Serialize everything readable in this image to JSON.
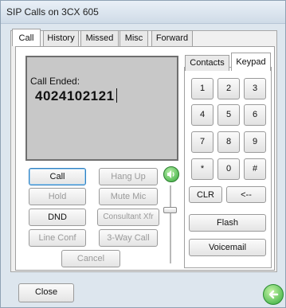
{
  "window": {
    "title": "SIP Calls on 3CX 605"
  },
  "tabs": [
    "Call",
    "History",
    "Missed",
    "Misc",
    "Forward"
  ],
  "display": {
    "status": "Call Ended:",
    "number": "4024102121"
  },
  "buttons": {
    "call": "Call",
    "hang_up": "Hang Up",
    "hold": "Hold",
    "mute_mic": "Mute Mic",
    "dnd": "DND",
    "consultant_xfr": "Consultant Xfr",
    "line_conf": "Line Conf",
    "three_way": "3-Way Call",
    "cancel": "Cancel",
    "close": "Close"
  },
  "right_tabs": [
    "Contacts",
    "Keypad"
  ],
  "keypad": {
    "keys": [
      "1",
      "2",
      "3",
      "4",
      "5",
      "6",
      "7",
      "8",
      "9",
      "*",
      "0",
      "#"
    ],
    "clr": "CLR",
    "back": "<--",
    "flash": "Flash",
    "voicemail": "Voicemail"
  },
  "icons": {
    "speaker": "speaker-icon",
    "go": "green-arrow-icon"
  },
  "colors": {
    "accent_green": "#34a83a",
    "display_bg": "#c8c8c8"
  }
}
